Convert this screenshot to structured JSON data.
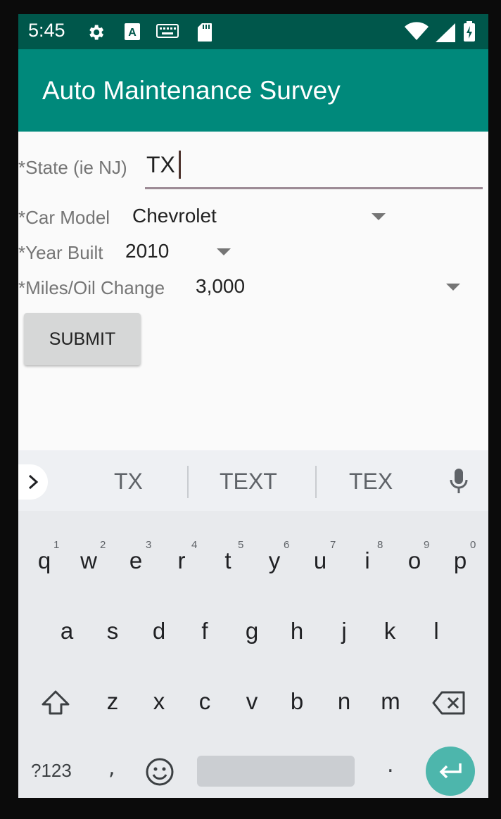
{
  "status_bar": {
    "time": "5:45"
  },
  "app_bar": {
    "title": "Auto Maintenance Survey"
  },
  "form": {
    "state": {
      "label": "*State (ie NJ)",
      "value": "TX"
    },
    "car_model": {
      "label": "*Car Model",
      "value": "Chevrolet"
    },
    "year_built": {
      "label": "*Year Built",
      "value": "2010"
    },
    "miles_oil_change": {
      "label": "*Miles/Oil Change",
      "value": "3,000"
    },
    "submit_label": "SUBMIT"
  },
  "keyboard": {
    "suggestions": [
      "TX",
      "TEXT",
      "TEX"
    ],
    "row1": [
      {
        "key": "q",
        "hint": "1"
      },
      {
        "key": "w",
        "hint": "2"
      },
      {
        "key": "e",
        "hint": "3"
      },
      {
        "key": "r",
        "hint": "4"
      },
      {
        "key": "t",
        "hint": "5"
      },
      {
        "key": "y",
        "hint": "6"
      },
      {
        "key": "u",
        "hint": "7"
      },
      {
        "key": "i",
        "hint": "8"
      },
      {
        "key": "o",
        "hint": "9"
      },
      {
        "key": "p",
        "hint": "0"
      }
    ],
    "row2": [
      "a",
      "s",
      "d",
      "f",
      "g",
      "h",
      "j",
      "k",
      "l"
    ],
    "row3": [
      "z",
      "x",
      "c",
      "v",
      "b",
      "n",
      "m"
    ],
    "symbols_label": "?123",
    "comma": ",",
    "period": "."
  },
  "colors": {
    "status_bar": "#00574b",
    "app_bar": "#00897b",
    "enter_key": "#4db6ac",
    "submit_button": "#d6d7d7"
  }
}
